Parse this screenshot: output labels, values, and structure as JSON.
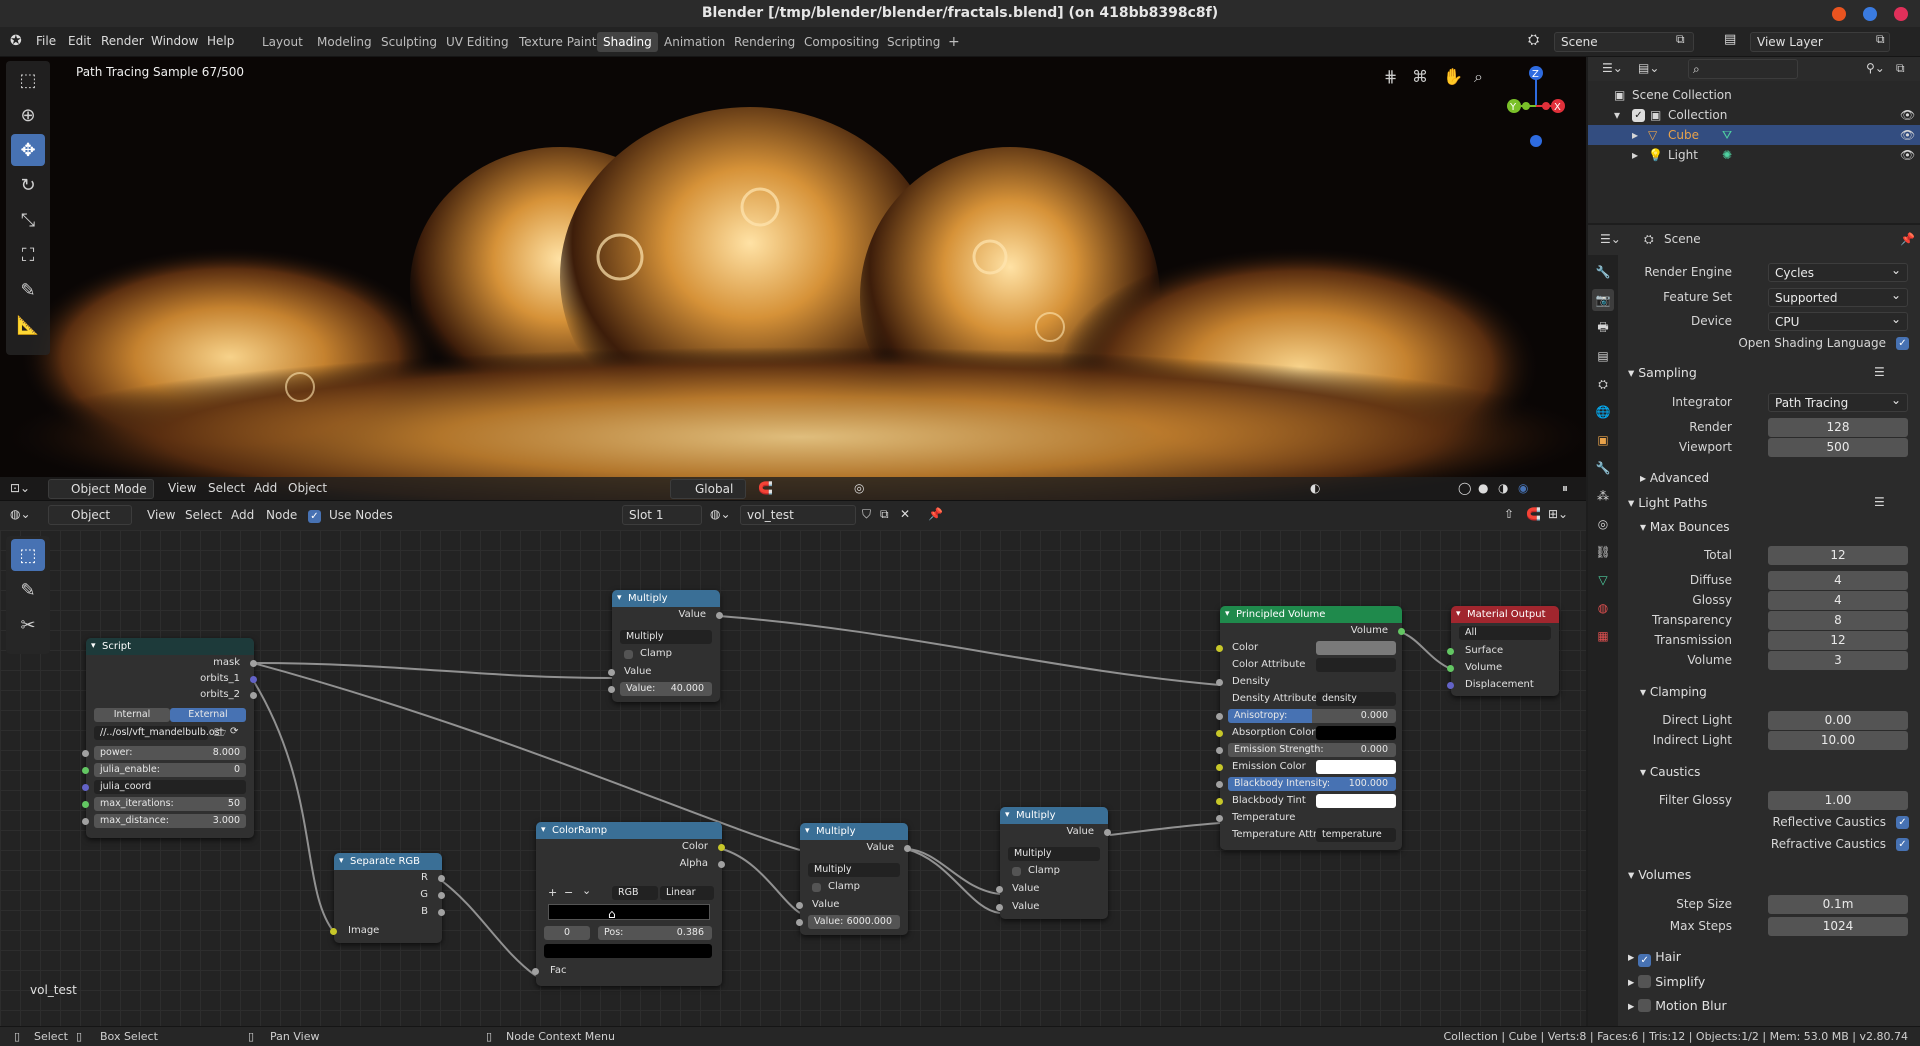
{
  "window": {
    "title": "Blender [/tmp/blender/blender/fractals.blend] (on 418bb8398c8f)"
  },
  "menu": {
    "items": [
      "File",
      "Edit",
      "Render",
      "Window",
      "Help"
    ]
  },
  "workspaces": [
    "Layout",
    "Modeling",
    "Sculpting",
    "UV Editing",
    "Texture Paint",
    "Shading",
    "Animation",
    "Rendering",
    "Compositing",
    "Scripting"
  ],
  "active_workspace": "Shading",
  "scene_field": "Scene",
  "view_layer_field": "View Layer",
  "viewport": {
    "render_status": "Path Tracing Sample 67/500",
    "mode": "Object Mode",
    "menus": [
      "View",
      "Select",
      "Add",
      "Object"
    ],
    "orientation": "Global"
  },
  "node_editor": {
    "object_dropdown": "Object",
    "menus": [
      "View",
      "Select",
      "Add",
      "Node"
    ],
    "use_nodes_label": "Use Nodes",
    "slot": "Slot 1",
    "material_name": "vol_test",
    "corner_label": "vol_test"
  },
  "nodes": {
    "script": {
      "title": "Script",
      "outputs": [
        "mask",
        "orbits_1",
        "orbits_2"
      ],
      "mode_internal": "Internal",
      "mode_external": "External",
      "path": "//../osl/vft_mandelbulb.osl",
      "power_label": "power:",
      "power_value": "8.000",
      "julia_enable_label": "julia_enable:",
      "julia_enable_value": "0",
      "julia_coord_label": "julia_coord",
      "max_iterations_label": "max_iterations:",
      "max_iterations_value": "50",
      "max_distance_label": "max_distance:",
      "max_distance_value": "3.000"
    },
    "multiply_top": {
      "title": "Multiply",
      "output": "Value",
      "op": "Multiply",
      "clamp": "Clamp",
      "input": "Value",
      "value_field": "Value:",
      "value": "40.000"
    },
    "separate_rgb": {
      "title": "Separate RGB",
      "r": "R",
      "g": "G",
      "b": "B",
      "input": "Image"
    },
    "colorramp": {
      "title": "ColorRamp",
      "out_color": "Color",
      "out_alpha": "Alpha",
      "mode": "RGB",
      "interp": "Linear",
      "index": "0",
      "pos_label": "Pos:",
      "pos": "0.386",
      "input": "Fac",
      "buttons": [
        "+",
        "−",
        "⌄"
      ]
    },
    "multiply_mid": {
      "title": "Multiply",
      "output": "Value",
      "op": "Multiply",
      "clamp": "Clamp",
      "input": "Value",
      "value_field": "Value:",
      "value": "6000.000"
    },
    "multiply_right": {
      "title": "Multiply",
      "output": "Value",
      "op": "Multiply",
      "clamp": "Clamp",
      "input1": "Value",
      "input2": "Value"
    },
    "principled_volume": {
      "title": "Principled Volume",
      "output": "Volume",
      "color": "Color",
      "color_attribute": "Color Attribute",
      "density": "Density",
      "density_attribute_label": "Density Attribute",
      "density_attribute": "density",
      "anisotropy_label": "Anisotropy:",
      "anisotropy": "0.000",
      "absorption_color": "Absorption Color",
      "emission_strength_label": "Emission Strength:",
      "emission_strength": "0.000",
      "emission_color": "Emission Color",
      "blackbody_intensity_label": "Blackbody Intensity:",
      "blackbody_intensity": "100.000",
      "blackbody_tint": "Blackbody Tint",
      "temperature": "Temperature",
      "temperature_attribute_label": "Temperature Attri...",
      "temperature_attribute": "temperature"
    },
    "material_output": {
      "title": "Material Output",
      "target": "All",
      "surface": "Surface",
      "volume": "Volume",
      "displacement": "Displacement"
    }
  },
  "outliner": {
    "root": "Scene Collection",
    "collection": "Collection",
    "items": [
      "Cube",
      "Light"
    ]
  },
  "properties": {
    "context": "Scene",
    "render_engine_label": "Render Engine",
    "render_engine": "Cycles",
    "feature_set_label": "Feature Set",
    "feature_set": "Supported",
    "device_label": "Device",
    "device": "CPU",
    "osl_label": "Open Shading Language",
    "sampling": {
      "title": "Sampling",
      "integrator_label": "Integrator",
      "integrator": "Path Tracing",
      "render_label": "Render",
      "render": "128",
      "viewport_label": "Viewport",
      "viewport": "500",
      "advanced": "Advanced"
    },
    "light_paths": {
      "title": "Light Paths",
      "max_bounces": "Max Bounces",
      "total_label": "Total",
      "total": "12",
      "diffuse_label": "Diffuse",
      "diffuse": "4",
      "glossy_label": "Glossy",
      "glossy": "4",
      "transparency_label": "Transparency",
      "transparency": "8",
      "transmission_label": "Transmission",
      "transmission": "12",
      "volume_label": "Volume",
      "volume": "3"
    },
    "clamping": {
      "title": "Clamping",
      "direct_label": "Direct Light",
      "direct": "0.00",
      "indirect_label": "Indirect Light",
      "indirect": "10.00"
    },
    "caustics": {
      "title": "Caustics",
      "filter_glossy_label": "Filter Glossy",
      "filter_glossy": "1.00",
      "reflective": "Reflective Caustics",
      "refractive": "Refractive Caustics"
    },
    "volumes": {
      "title": "Volumes",
      "step_size_label": "Step Size",
      "step_size": "0.1m",
      "max_steps_label": "Max Steps",
      "max_steps": "1024"
    },
    "hair": "Hair",
    "simplify": "Simplify",
    "motion_blur": "Motion Blur"
  },
  "statusbar": {
    "select": "Select",
    "box_select": "Box Select",
    "pan_view": "Pan View",
    "node_context": "Node Context Menu",
    "stats": "Collection | Cube | Verts:8 | Faces:6 | Tris:12 | Objects:1/2 | Mem: 53.0 MB | v2.80.74"
  },
  "colors": {
    "accent": "#4772b3",
    "script_header": "#1d3a3a",
    "converter_header": "#3a6f96",
    "shader_header": "#1f8a4c",
    "output_header": "#a1262e"
  }
}
